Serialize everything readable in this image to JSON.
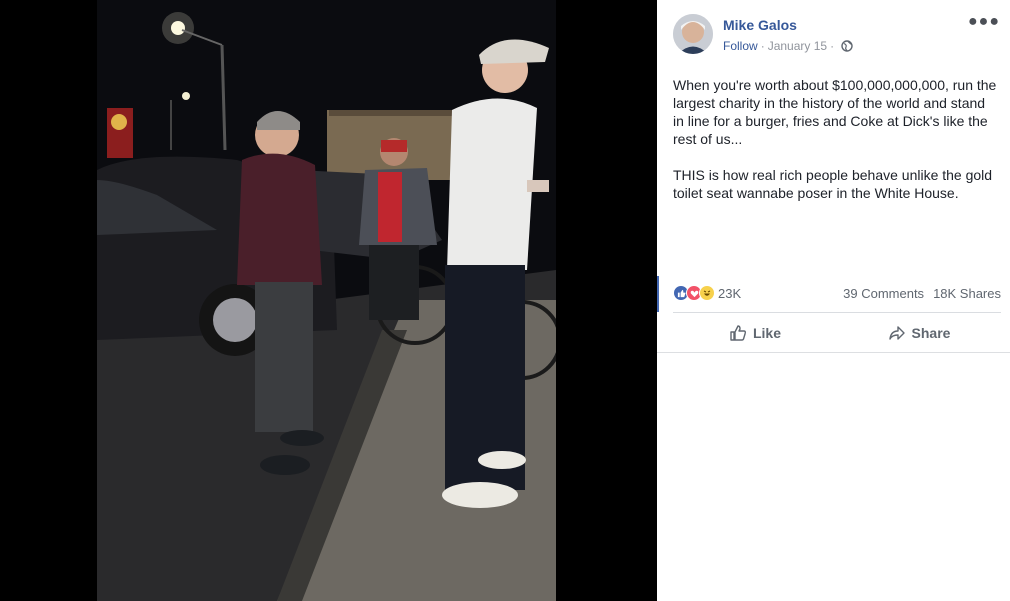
{
  "post": {
    "author": "Mike Galos",
    "follow_label": "Follow",
    "date": "January 15",
    "meta_separator": "·",
    "paragraphs": [
      "When you're worth about $100,000,000,000, run the largest charity in the history of the world and stand in line for a burger, fries and Coke at Dick's like the rest of us...",
      "THIS is how real rich people behave unlike the gold toilet seat wannabe poser in the White House."
    ]
  },
  "reactions": {
    "count": "23K",
    "types": [
      "like",
      "love",
      "haha"
    ],
    "comments": "39 Comments",
    "shares": "18K Shares"
  },
  "actions": {
    "like_label": "Like",
    "share_label": "Share"
  },
  "icons": {
    "more": "more-options-icon",
    "privacy": "globe-icon",
    "like": "thumbs-up-icon",
    "share": "share-arrow-icon"
  },
  "colors": {
    "author_link": "#365899",
    "meta_gray": "#90949c",
    "text": "#1d2129",
    "love": "#f25268",
    "like": "#4267b2",
    "haha": "#f7d14c"
  }
}
